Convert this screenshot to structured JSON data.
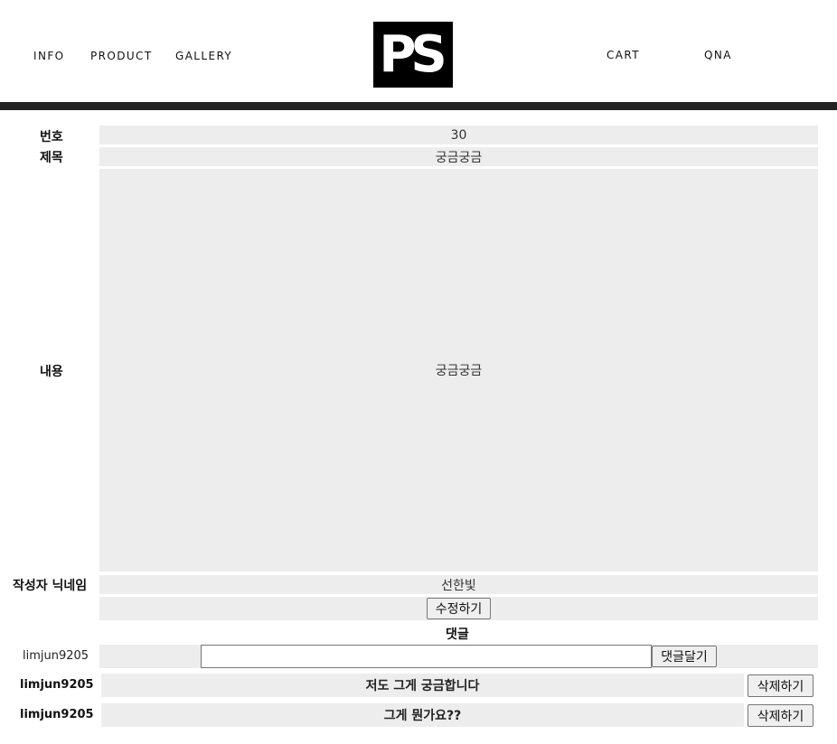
{
  "header": {
    "nav_left": [
      "INFO",
      "PRODUCT",
      "GALLERY"
    ],
    "logo_text": "PS",
    "nav_right": [
      "CART",
      "QNA"
    ]
  },
  "post": {
    "number_label": "번호",
    "number_value": "30",
    "title_label": "제목",
    "title_value": "궁금궁금",
    "content_label": "내용",
    "content_value": "궁금궁금",
    "author_label": "작성자 닉네임",
    "author_value": "선한빛",
    "edit_button": "수정하기"
  },
  "comments": {
    "header": "댓글",
    "current_user": "limjun9205",
    "input_value": "",
    "submit_button": "댓글달기",
    "items": [
      {
        "user": "limjun9205",
        "text": "저도 그게 궁금합니다",
        "delete_button": "삭제하기"
      },
      {
        "user": "limjun9205",
        "text": "그게 뭔가요??",
        "delete_button": "삭제하기"
      }
    ]
  }
}
